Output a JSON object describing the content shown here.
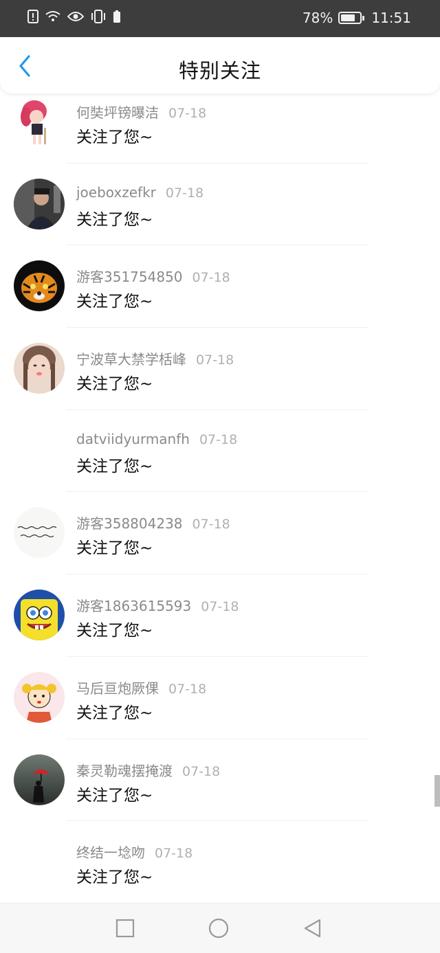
{
  "status_bar": {
    "battery": "78%",
    "time": "11:51",
    "battery_level": 0.78
  },
  "header": {
    "title": "特别关注"
  },
  "items": [
    {
      "name": "何奘坪镑曝洁",
      "date": "07-18",
      "message": "关注了您~",
      "avatar": "anime-girl"
    },
    {
      "name": "joeboxzefkr",
      "date": "07-18",
      "message": "关注了您~",
      "avatar": "man-photo"
    },
    {
      "name": "游客351754850",
      "date": "07-18",
      "message": "关注了您~",
      "avatar": "tiger"
    },
    {
      "name": "宁波草大禁学栝峰",
      "date": "07-18",
      "message": "关注了您~",
      "avatar": "girl-photo"
    },
    {
      "name": "datviidyurmanfh",
      "date": "07-18",
      "message": "关注了您~",
      "avatar": "none"
    },
    {
      "name": "游客358804238",
      "date": "07-18",
      "message": "关注了您~",
      "avatar": "calligraphy"
    },
    {
      "name": "游客1863615593",
      "date": "07-18",
      "message": "关注了您~",
      "avatar": "sponge"
    },
    {
      "name": "马后亘炮厥倮",
      "date": "07-18",
      "message": "关注了您~",
      "avatar": "cartoon-girl"
    },
    {
      "name": "秦灵勒魂摆掩渡",
      "date": "07-18",
      "message": "关注了您~",
      "avatar": "umbrella"
    },
    {
      "name": "终结一埝吻",
      "date": "07-18",
      "message": "关注了您~",
      "avatar": "none"
    }
  ],
  "colors": {
    "accent": "#1e9be8",
    "status_bg": "#3d3d3d"
  }
}
